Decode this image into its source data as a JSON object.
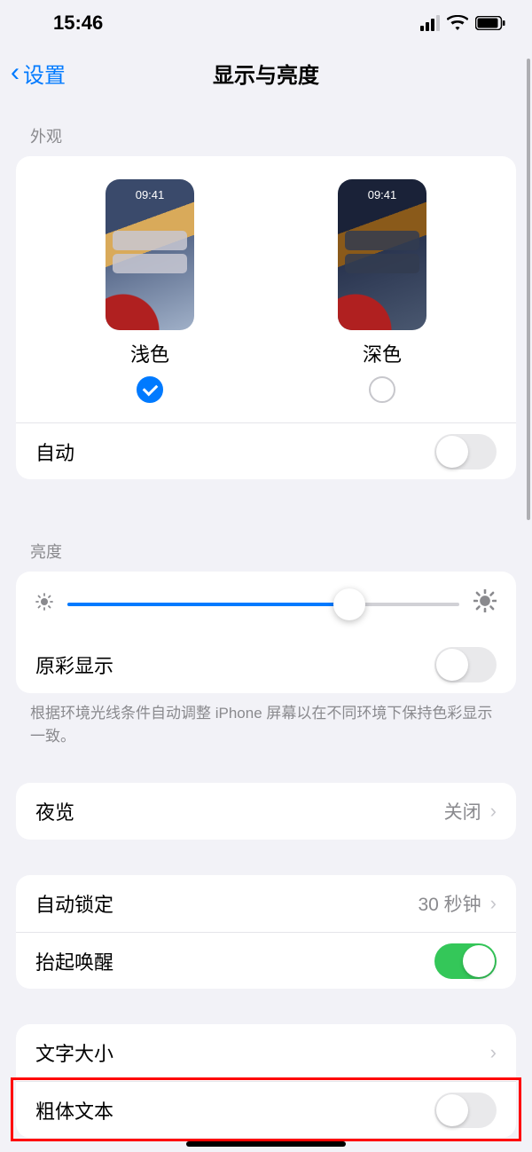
{
  "status": {
    "time": "15:46"
  },
  "nav": {
    "back_label": "设置",
    "title": "显示与亮度"
  },
  "appearance": {
    "header": "外观",
    "time_sample": "09:41",
    "light_label": "浅色",
    "dark_label": "深色",
    "selected": "light",
    "auto_label": "自动",
    "auto_on": false
  },
  "brightness": {
    "header": "亮度",
    "value_percent": 72,
    "true_tone_label": "原彩显示",
    "true_tone_on": false,
    "true_tone_note": "根据环境光线条件自动调整 iPhone 屏幕以在不同环境下保持色彩显示一致。"
  },
  "night_shift": {
    "label": "夜览",
    "value": "关闭"
  },
  "auto_lock": {
    "label": "自动锁定",
    "value": "30 秒钟"
  },
  "raise_to_wake": {
    "label": "抬起唤醒",
    "on": true
  },
  "text_size": {
    "label": "文字大小"
  },
  "bold_text": {
    "label": "粗体文本",
    "on": false
  }
}
